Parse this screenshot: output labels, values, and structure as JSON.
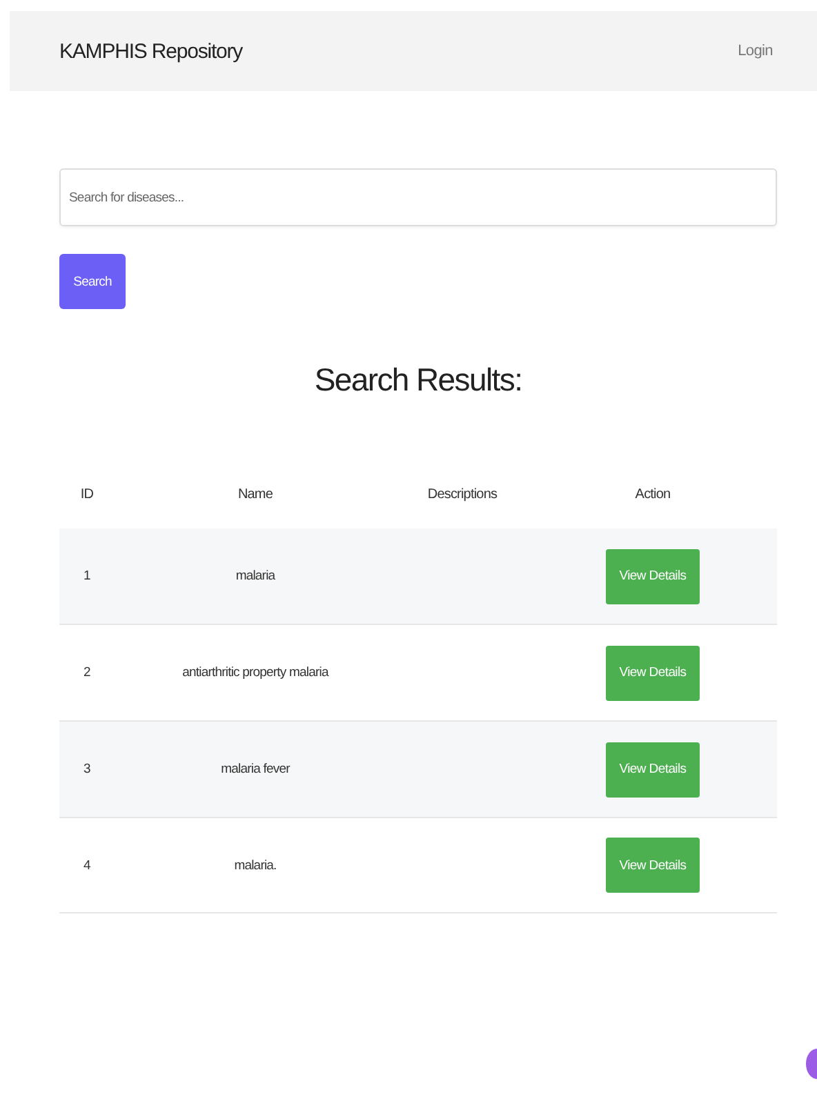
{
  "navbar": {
    "brand": "KAMPHIS Repository",
    "login": "Login"
  },
  "search": {
    "placeholder": "Search for diseases...",
    "button": "Search"
  },
  "results": {
    "title": "Search Results:",
    "columns": [
      "ID",
      "Name",
      "Descriptions",
      "Action"
    ],
    "rows": [
      {
        "id": "1",
        "name": "malaria",
        "action": "View Details"
      },
      {
        "id": "2",
        "name": "antiarthritic property malaria",
        "action": "View Details"
      },
      {
        "id": "3",
        "name": "malaria fever",
        "action": "View Details"
      },
      {
        "id": "4",
        "name": "malaria.",
        "action": "View Details"
      }
    ]
  }
}
